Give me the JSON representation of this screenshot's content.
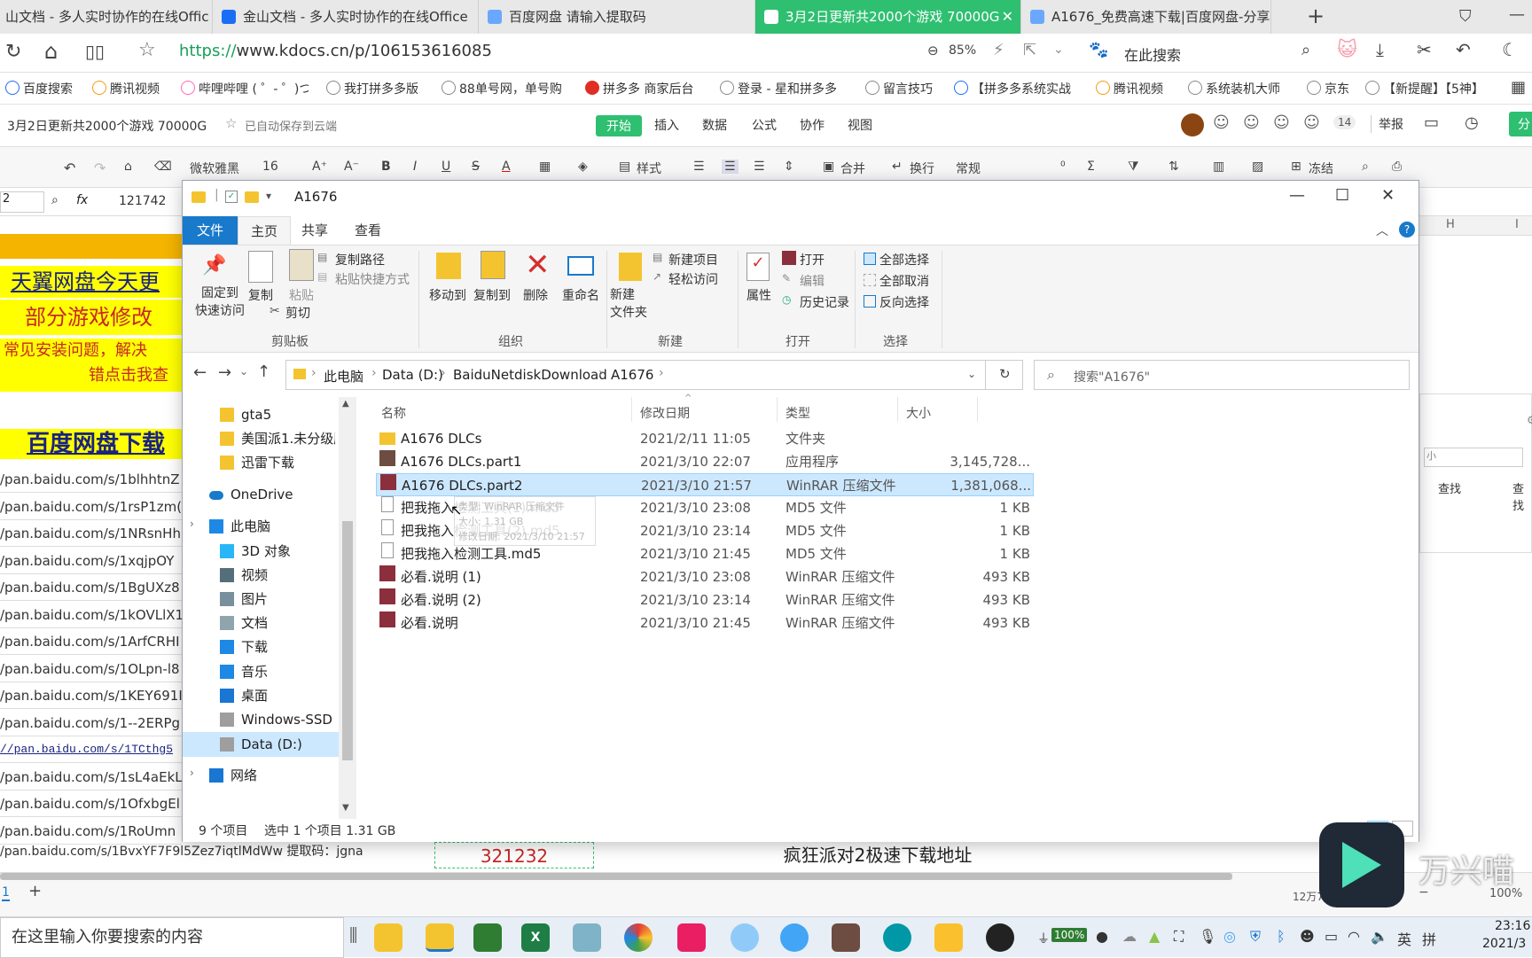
{
  "browser": {
    "tabs": [
      {
        "label": "山文档 - 多人实时协作的在线Offic",
        "active": false
      },
      {
        "label": "金山文档 - 多人实时协作的在线Office",
        "active": false
      },
      {
        "label": "百度网盘 请输入提取码",
        "active": false
      },
      {
        "label": "3月2日更新共2000个游戏 70000G",
        "active": true
      },
      {
        "label": "A1676_免费高速下载|百度网盘-分享无",
        "active": false
      }
    ],
    "url_protocol": "https://",
    "url_rest": "www.kdocs.cn/p/106153616085",
    "zoom": "85%",
    "search_placeholder": "在此搜索",
    "bookmarks": [
      "百度搜索",
      "腾讯视频",
      "哔哩哔哩 ( ゜- ゜)つ",
      "我打拼多多版",
      "88单号网，单号购",
      "拼多多 商家后台",
      "登录 - 星和拼多多",
      "留言技巧",
      "【拼多多系统实战",
      "腾讯视频",
      "系统装机大师",
      "京东",
      "【新提醒】【5神】"
    ]
  },
  "doc": {
    "title": "3月2日更新共2000个游戏 70000G",
    "autosave": "已自动保存到云端",
    "menu": [
      "开始",
      "插入",
      "数据",
      "公式",
      "协作",
      "视图"
    ],
    "collab_count": "14",
    "report": "举报",
    "share": "分",
    "font_name": "微软雅黑",
    "font_size": "16",
    "tools": [
      "样式",
      "合并",
      "换行",
      "常规",
      "冻结"
    ],
    "cell_ref": "2",
    "formula_value": "121742",
    "col_h": "H",
    "col_i": "I"
  },
  "sheet": {
    "banner1": "天翼网盘今天更",
    "banner2": "部分游戏修改",
    "banner3a": "常见安装问题，解决",
    "banner3b": "错点击我查",
    "banner4": "百度网盘下载",
    "links": [
      "/pan.baidu.com/s/1blhhtnZ",
      "/pan.baidu.com/s/1rsP1zm(",
      "/pan.baidu.com/s/1NRsnHh",
      "/pan.baidu.com/s/1xqjpOY",
      "/pan.baidu.com/s/1BgUXz8",
      "/pan.baidu.com/s/1kOVLlX1",
      "/pan.baidu.com/s/1ArfCRHI",
      "/pan.baidu.com/s/1OLpn-l8",
      "/pan.baidu.com/s/1KEY691I",
      "/pan.baidu.com/s/1--2ERPg",
      "//pan.baidu.com/s/1TCthg5",
      "/pan.baidu.com/s/1sL4aEkL",
      "/pan.baidu.com/s/1OfxbgEl",
      "/pan.baidu.com/s/1RoUmn"
    ],
    "last_row": "/pan.baidu.com/s/1BvxYF7F9l5Zez7iqtlMdWw 提取码：jgna",
    "code": "321232",
    "footer_note": "疯狂派对2极速下载地址",
    "sheet_tab": "1",
    "find1": "查找",
    "find2": "查找",
    "right_hint": "小",
    "stat_right": "12万7742",
    "zoom_right": "100%"
  },
  "explorer": {
    "title": "A1676",
    "ribbon_tabs": [
      "文件",
      "主页",
      "共享",
      "查看"
    ],
    "ribbon": {
      "pin": "固定到\n快速访问",
      "copy": "复制",
      "paste": "粘贴",
      "copy_path": "复制路径",
      "paste_shortcut": "粘贴快捷方式",
      "cut": "剪切",
      "group_clipboard": "剪贴板",
      "move_to": "移动到",
      "copy_to": "复制到",
      "delete": "删除",
      "rename": "重命名",
      "group_organize": "组织",
      "new_item": "新建项目",
      "easy_access": "轻松访问",
      "new_folder": "新建\n文件夹",
      "group_new": "新建",
      "properties": "属性",
      "open": "打开",
      "edit": "编辑",
      "history": "历史记录",
      "group_open": "打开",
      "select_all": "全部选择",
      "select_none": "全部取消",
      "invert": "反向选择",
      "group_select": "选择"
    },
    "path": [
      "此电脑",
      "Data (D:)",
      "BaiduNetdiskDownload",
      "A1676"
    ],
    "search_placeholder": "搜索\"A1676\"",
    "sidebar": [
      "gta5",
      "美国派1.未分级版",
      "迅雷下载",
      "OneDrive",
      "此电脑",
      "3D 对象",
      "视频",
      "图片",
      "文档",
      "下载",
      "音乐",
      "桌面",
      "Windows-SSD",
      "Data (D:)",
      "网络"
    ],
    "columns": [
      "名称",
      "修改日期",
      "类型",
      "大小"
    ],
    "files": [
      {
        "name": "A1676 DLCs",
        "date": "2021/2/11 11:05",
        "type": "文件夹",
        "size": "",
        "icon": "folder"
      },
      {
        "name": "A1676 DLCs.part1",
        "date": "2021/3/10 22:07",
        "type": "应用程序",
        "size": "3,145,728...",
        "icon": "exe"
      },
      {
        "name": "A1676 DLCs.part2",
        "date": "2021/3/10 21:57",
        "type": "WinRAR 压缩文件",
        "size": "1,381,068...",
        "icon": "rar"
      },
      {
        "name": "把我拖入检测工具(1).md5",
        "date": "2021/3/10 23:08",
        "type": "MD5 文件",
        "size": "1 KB",
        "icon": "file"
      },
      {
        "name": "把我拖入检测工具(2).md5",
        "date": "2021/3/10 23:14",
        "type": "MD5 文件",
        "size": "1 KB",
        "icon": "file"
      },
      {
        "name": "把我拖入检测工具.md5",
        "date": "2021/3/10 21:45",
        "type": "MD5 文件",
        "size": "1 KB",
        "icon": "file"
      },
      {
        "name": "必看.说明 (1)",
        "date": "2021/3/10 23:08",
        "type": "WinRAR 压缩文件",
        "size": "493 KB",
        "icon": "rar"
      },
      {
        "name": "必看.说明 (2)",
        "date": "2021/3/10 23:14",
        "type": "WinRAR 压缩文件",
        "size": "493 KB",
        "icon": "rar"
      },
      {
        "name": "必看.说明",
        "date": "2021/3/10 21:45",
        "type": "WinRAR 压缩文件",
        "size": "493 KB",
        "icon": "rar"
      }
    ],
    "tooltip_line1": "类型: WinRAR 压缩文件",
    "tooltip_line2": "大小: 1.31 GB",
    "tooltip_line3": "修改日期: 2021/3/10 21:57",
    "status_count": "9 个项目",
    "status_selected": "选中 1 个项目  1.31 GB"
  },
  "watermark": "万兴喵",
  "taskbar": {
    "search_placeholder": "在这里输入你要搜索的内容",
    "battery": "100%",
    "ime1": "英",
    "ime2": "拼",
    "time": "23:16",
    "date": "2021/3"
  },
  "colors": {
    "accent_green": "#2fbf71",
    "explorer_blue": "#1979ca",
    "selection": "#cce8ff",
    "sheet_yellow": "#ffff00"
  }
}
